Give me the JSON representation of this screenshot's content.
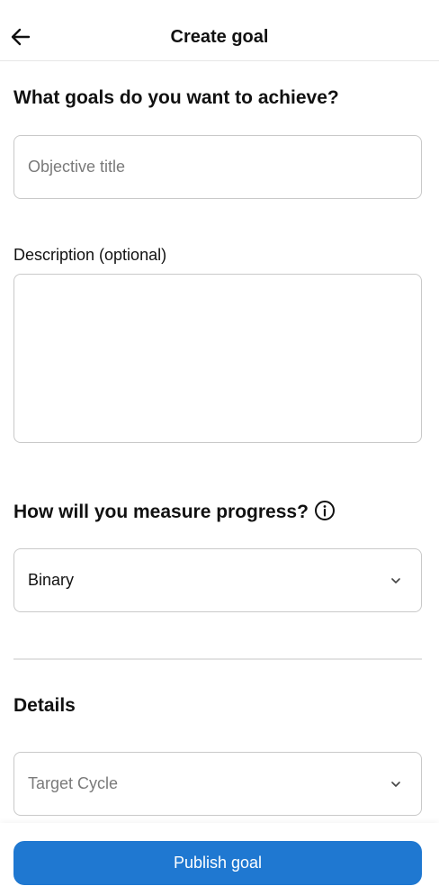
{
  "header": {
    "title": "Create goal",
    "back_icon": "arrow-left-icon"
  },
  "objective": {
    "heading": "What goals do you want to achieve?",
    "placeholder": "Objective title",
    "value": ""
  },
  "description": {
    "label": "Description (optional)",
    "value": ""
  },
  "measure": {
    "heading": "How will you measure progress?",
    "info_icon": "info-icon",
    "selected": "Binary"
  },
  "details": {
    "heading": "Details",
    "target_cycle_placeholder": "Target Cycle"
  },
  "footer": {
    "publish_label": "Publish goal"
  },
  "colors": {
    "accent": "#1f78d1",
    "border": "#c9c9c9",
    "placeholder": "#7a7a7a"
  }
}
